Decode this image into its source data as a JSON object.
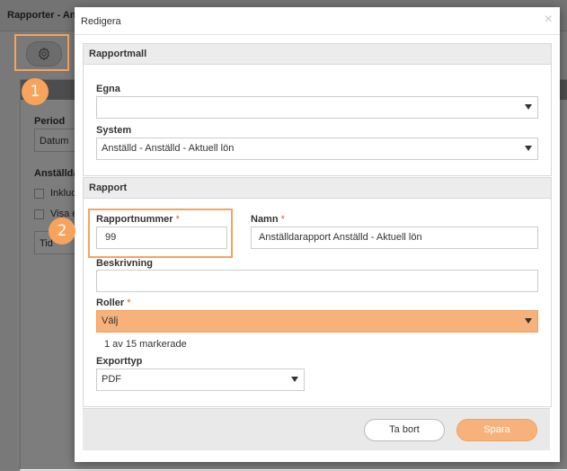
{
  "background": {
    "title": "Rapporter - An",
    "gear_icon": "gear-icon",
    "period_label": "Period",
    "period_value": "Datum",
    "employees_label": "Anställda",
    "checkbox1_label": "Inklude",
    "checkbox2_label": "Visa e",
    "select3_value": "Tid"
  },
  "callouts": {
    "badge1": "1",
    "badge2": "2",
    "color": "#f7a35c"
  },
  "modal": {
    "title": "Redigera",
    "close": "×",
    "template_section": {
      "heading": "Rapportmall",
      "own_label": "Egna",
      "own_value": "",
      "system_label": "System",
      "system_value": "Anställd - Anställd - Aktuell lön"
    },
    "report_section": {
      "heading": "Rapport",
      "number_label": "Rapportnummer",
      "number_value": "99",
      "name_label": "Namn",
      "name_value": "Anställdarapport Anställd - Aktuell lön",
      "required_mark": "*",
      "description_label": "Beskrivning",
      "description_value": "",
      "roles_label": "Roller",
      "roles_value": "Välj",
      "roles_helper": "1 av 15 markerade",
      "export_label": "Exporttyp",
      "export_value": "PDF"
    },
    "footer": {
      "delete_label": "Ta bort",
      "save_label": "Spara"
    }
  },
  "colors": {
    "accent": "#f7b27b",
    "required": "#e2583e"
  }
}
